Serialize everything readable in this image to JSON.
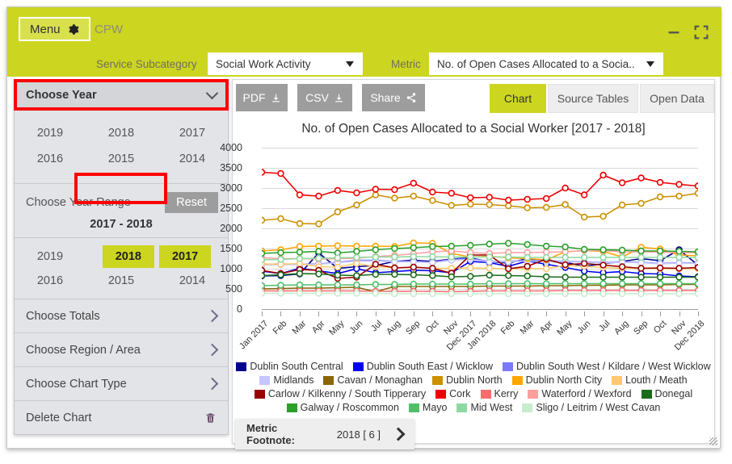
{
  "header": {
    "menu_label": "Menu",
    "gear_icon": "gear-icon",
    "app_name": "CPW",
    "minimize_icon": "minimize-icon",
    "fullscreen_icon": "fullscreen-icon",
    "subcategory_label": "Service Subcategory",
    "subcategory_value": "Social Work Activity",
    "metric_label": "Metric",
    "metric_value": "No. of Open Cases Allocated to a Socia.."
  },
  "menu_panel": {
    "title": "Choose Year",
    "chevron_icon": "chevron-down-icon",
    "years": [
      "2019",
      "2018",
      "2017",
      "2016",
      "2015",
      "2014"
    ],
    "range_label": "Choose Year Range",
    "reset_label": "Reset",
    "range_value": "2017 - 2018",
    "range_years_row1": [
      "2019",
      "2018",
      "2017"
    ],
    "range_years_row2": [
      "2016",
      "2015",
      "2014"
    ],
    "selected_years": [
      "2018",
      "2017"
    ],
    "items": [
      {
        "label": "Choose Totals",
        "icon": "chevron-right-icon"
      },
      {
        "label": "Choose Region / Area",
        "icon": "chevron-right-icon"
      },
      {
        "label": "Choose Chart Type",
        "icon": "chevron-right-icon"
      },
      {
        "label": "Delete Chart",
        "icon": "trash-icon"
      }
    ]
  },
  "toolbar": {
    "pdf_label": "PDF",
    "pdf_icon": "download-icon",
    "csv_label": "CSV",
    "csv_icon": "download-icon",
    "share_label": "Share",
    "share_icon": "share-icon",
    "tabs": [
      {
        "label": "Chart",
        "active": true
      },
      {
        "label": "Source Tables",
        "active": false
      },
      {
        "label": "Open Data",
        "active": false
      }
    ]
  },
  "footnote": {
    "label": "Metric Footnote:",
    "value": "2018 [ 6 ]",
    "icon": "chevron-right-icon"
  },
  "colors": {
    "brand_olive": "#ccd51f",
    "annotation_red": "#ff0000",
    "toolbar_grey": "#9d9d9d",
    "panel_grey": "#e2e4e8"
  },
  "chart_data": {
    "type": "line",
    "title": "No. of Open Cases Allocated to a Social Worker [2017 - 2018]",
    "xlabel": "",
    "ylabel": "",
    "ylim": [
      0,
      4000
    ],
    "yticks": [
      0,
      500,
      1000,
      1500,
      2000,
      2500,
      3000,
      3500,
      4000
    ],
    "grid": true,
    "legend_position": "bottom",
    "markers": "open-circle",
    "x": [
      "Jan 2017",
      "Feb",
      "Mar",
      "Apr",
      "May",
      "Jun",
      "Jul",
      "Aug",
      "Sep",
      "Oct",
      "Nov",
      "Dec 2017",
      "Jan 2018",
      "Feb",
      "Mar",
      "Apr",
      "May",
      "Jun",
      "Jul",
      "Aug",
      "Sep",
      "Oct",
      "Nov",
      "Dec 2018"
    ],
    "series": [
      {
        "name": "Dublin South Central",
        "color": "#00008b",
        "values": [
          820,
          830,
          870,
          1390,
          1010,
          1050,
          1080,
          1180,
          1210,
          1180,
          1240,
          1270,
          1170,
          1140,
          1250,
          1180,
          1160,
          1060,
          1120,
          1180,
          1250,
          1200,
          1470,
          1090
        ]
      },
      {
        "name": "Dublin South East / Wicklow",
        "color": "#0000ee",
        "values": [
          940,
          880,
          1010,
          950,
          880,
          1000,
          900,
          930,
          960,
          950,
          900,
          1180,
          1150,
          1060,
          1190,
          1110,
          1030,
          940,
          900,
          930,
          880,
          870,
          820,
          800
        ]
      },
      {
        "name": "Dublin South West / Kildare / West Wicklow",
        "color": "#7a7aff",
        "values": [
          1110,
          1120,
          1110,
          1120,
          1160,
          1210,
          1210,
          1180,
          1180,
          1160,
          1230,
          1250,
          1180,
          1180,
          1210,
          1200,
          1180,
          1170,
          1150,
          1170,
          1160,
          1130,
          1150,
          1140
        ]
      },
      {
        "name": "Midlands",
        "color": "#c6c6ff",
        "values": [
          1090,
          1100,
          1100,
          1110,
          1150,
          1190,
          1190,
          1170,
          1170,
          1150,
          1210,
          1230,
          1170,
          1170,
          1190,
          1180,
          1170,
          1160,
          1140,
          1160,
          1150,
          1120,
          1140,
          1130
        ]
      },
      {
        "name": "Cavan / Monaghan",
        "color": "#8b6508",
        "values": [
          500,
          510,
          520,
          520,
          530,
          540,
          430,
          560,
          560,
          560,
          560,
          560,
          570,
          570,
          570,
          580,
          580,
          590,
          590,
          600,
          600,
          600,
          610,
          610
        ]
      },
      {
        "name": "Dublin North",
        "color": "#cc9000",
        "values": [
          2200,
          2240,
          2120,
          2110,
          2410,
          2580,
          2830,
          2750,
          2800,
          2690,
          2570,
          2600,
          2590,
          2560,
          2510,
          2520,
          2590,
          2280,
          2300,
          2580,
          2620,
          2780,
          2800,
          2870
        ]
      },
      {
        "name": "Dublin North City",
        "color": "#ffa500",
        "values": [
          1440,
          1470,
          1550,
          1560,
          1570,
          1560,
          1560,
          1550,
          1640,
          1630,
          1380,
          1290,
          1310,
          1270,
          1250,
          1220,
          1420,
          1450,
          1430,
          1290,
          1530,
          1490,
          1340,
          1320
        ]
      },
      {
        "name": "Louth / Meath",
        "color": "#ffc96b",
        "values": [
          1120,
          1110,
          1130,
          1050,
          1040,
          1130,
          1050,
          1030,
          1030,
          1010,
          1010,
          1020,
          1010,
          1000,
          1010,
          1000,
          1080,
          1060,
          1030,
          1010,
          1010,
          1000,
          1000,
          1000
        ]
      },
      {
        "name": "Carlow / Kilkenny / South Tipperary",
        "color": "#990000",
        "values": [
          960,
          880,
          980,
          960,
          760,
          790,
          1110,
          1020,
          1040,
          1010,
          890,
          1340,
          1340,
          1000,
          1060,
          1240,
          1100,
          1130,
          1090,
          1050,
          1010,
          1020,
          1010,
          1030
        ]
      },
      {
        "name": "Cork",
        "color": "#ee0000",
        "values": [
          3390,
          3360,
          2830,
          2800,
          2940,
          2880,
          2970,
          2960,
          3120,
          2900,
          2870,
          2760,
          2770,
          2700,
          2720,
          2740,
          3000,
          2830,
          3320,
          3130,
          3250,
          3140,
          3090,
          3050
        ]
      },
      {
        "name": "Kerry",
        "color": "#f46e6e",
        "values": [
          450,
          450,
          450,
          450,
          450,
          450,
          440,
          440,
          440,
          440,
          430,
          440,
          450,
          450,
          450,
          450,
          460,
          460,
          460,
          460,
          460,
          460,
          460,
          460
        ]
      },
      {
        "name": "Waterford / Wexford",
        "color": "#ff9e9e",
        "values": [
          1270,
          1250,
          1250,
          1240,
          1250,
          1260,
          1300,
          1330,
          1370,
          1420,
          1440,
          1400,
          1380,
          1400,
          1400,
          1410,
          1420,
          1450,
          1450,
          1420,
          1420,
          1410,
          1400,
          1400
        ]
      },
      {
        "name": "Donegal",
        "color": "#1a6b1a",
        "values": [
          830,
          850,
          880,
          870,
          840,
          830,
          860,
          860,
          850,
          830,
          800,
          810,
          840,
          830,
          820,
          800,
          790,
          790,
          790,
          790,
          790,
          790,
          790,
          790
        ]
      },
      {
        "name": "Galway / Roscommon",
        "color": "#2aa02a",
        "values": [
          1380,
          1400,
          1410,
          1430,
          1390,
          1430,
          1470,
          1500,
          1520,
          1550,
          1560,
          1580,
          1610,
          1630,
          1600,
          1560,
          1540,
          1480,
          1470,
          1460,
          1440,
          1440,
          1430,
          1420
        ]
      },
      {
        "name": "Mayo",
        "color": "#4fbf6a",
        "values": [
          580,
          590,
          600,
          600,
          600,
          600,
          610,
          610,
          620,
          620,
          620,
          620,
          630,
          630,
          630,
          630,
          630,
          630,
          630,
          630,
          630,
          630,
          630,
          630
        ]
      },
      {
        "name": "Mid West",
        "color": "#8ed9a0",
        "values": [
          1220,
          1230,
          1250,
          1260,
          1270,
          1280,
          1290,
          1290,
          1300,
          1300,
          1290,
          1290,
          1290,
          1290,
          1280,
          1280,
          1280,
          1280,
          1280,
          1280,
          1280,
          1280,
          1280,
          1280
        ]
      },
      {
        "name": "Sligo / Leitrim / West Cavan",
        "color": "#c7ecce",
        "values": [
          390,
          390,
          390,
          390,
          390,
          390,
          390,
          380,
          380,
          380,
          380,
          380,
          380,
          380,
          380,
          380,
          380,
          380,
          380,
          380,
          380,
          380,
          380,
          380
        ]
      }
    ]
  }
}
